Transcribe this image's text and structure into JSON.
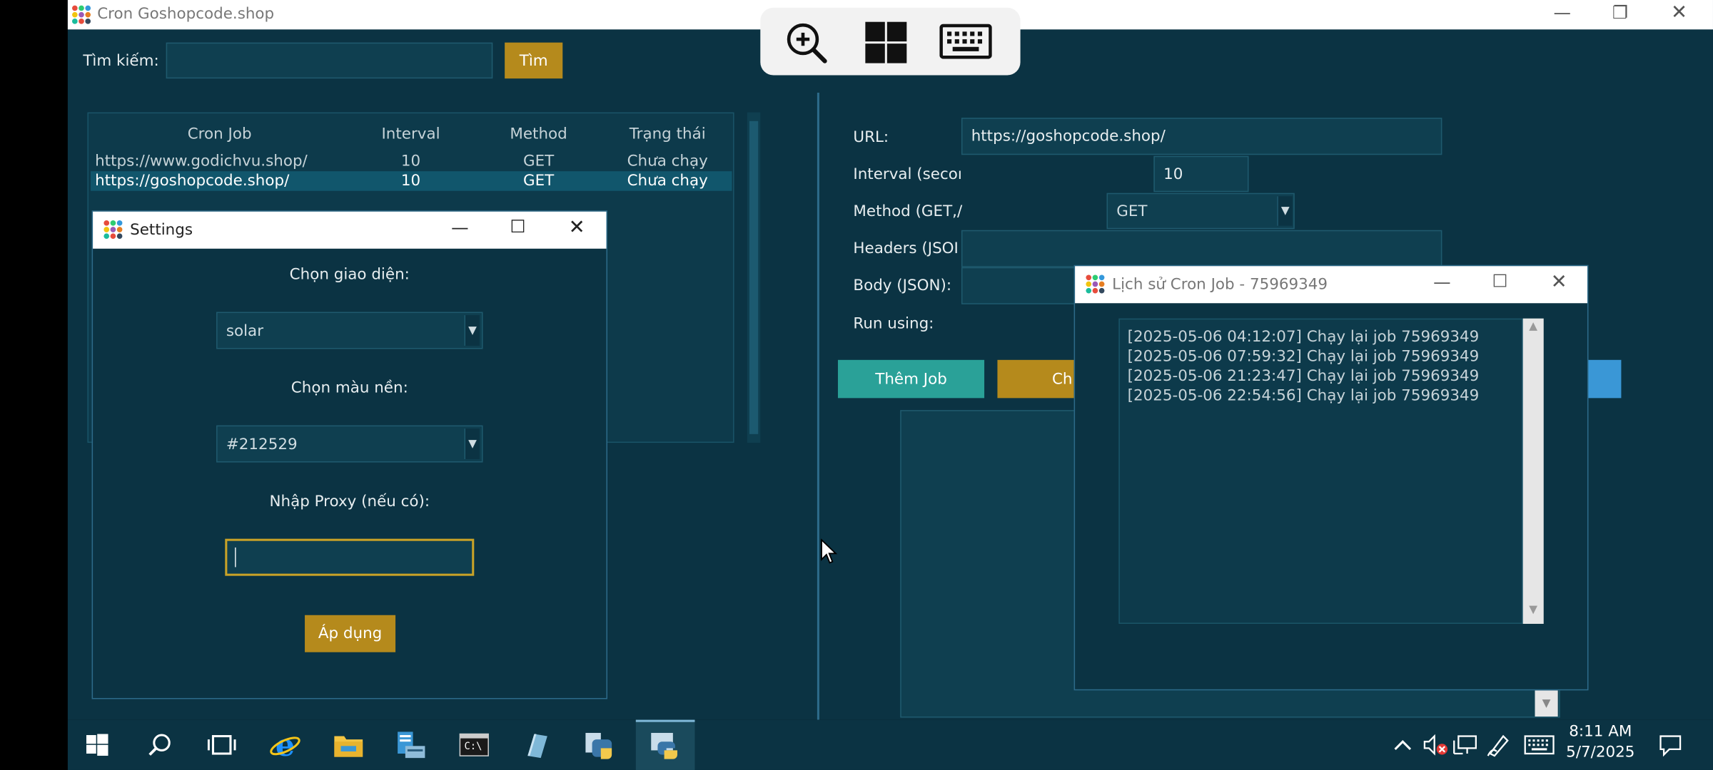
{
  "main": {
    "title": "Cron Goshopcode.shop",
    "search_label": "Tìm kiếm:",
    "search_value": "",
    "search_button": "Tìm",
    "columns": [
      "Cron Job",
      "Interval",
      "Method",
      "Trạng thái"
    ],
    "rows": [
      {
        "url": "https://www.godichvu.shop/",
        "interval": "10",
        "method": "GET",
        "status": "Chưa chạy"
      },
      {
        "url": "https://goshopcode.shop/",
        "interval": "10",
        "method": "GET",
        "status": "Chưa chạy"
      }
    ],
    "form": {
      "url_label": "URL:",
      "url_value": "https://goshopcode.shop/",
      "interval_label": "Interval (secoı",
      "interval_value": "10",
      "method_label": "Method (GET,/",
      "method_value": "GET",
      "headers_label": "Headers (JSOI",
      "body_label": "Body (JSON):",
      "run_label": "Run using:",
      "add_button": "Thêm Job",
      "second_button_partial": "Ch"
    }
  },
  "settings": {
    "title": "Settings",
    "theme_label": "Chọn giao diện:",
    "theme_value": "solar",
    "bg_label": "Chọn màu nền:",
    "bg_value": "#212529",
    "proxy_label": "Nhập Proxy (nếu có):",
    "proxy_value": "",
    "apply_button": "Áp dụng"
  },
  "history": {
    "title": "Lịch sử Cron Job - 75969349",
    "entries": [
      "[2025-05-06 04:12:07] Chạy lại job 75969349",
      "[2025-05-06 07:59:32] Chạy lại job 75969349",
      "[2025-05-06 21:23:47] Chạy lại job 75969349",
      "[2025-05-06 22:54:56] Chạy lại job 75969349"
    ]
  },
  "taskbar": {
    "time": "8:11 AM",
    "date": "5/7/2025"
  },
  "colors": {
    "background": "#0b3343",
    "gold": "#b58a1c",
    "teal": "#2aa198",
    "blue": "#3a97d6"
  }
}
